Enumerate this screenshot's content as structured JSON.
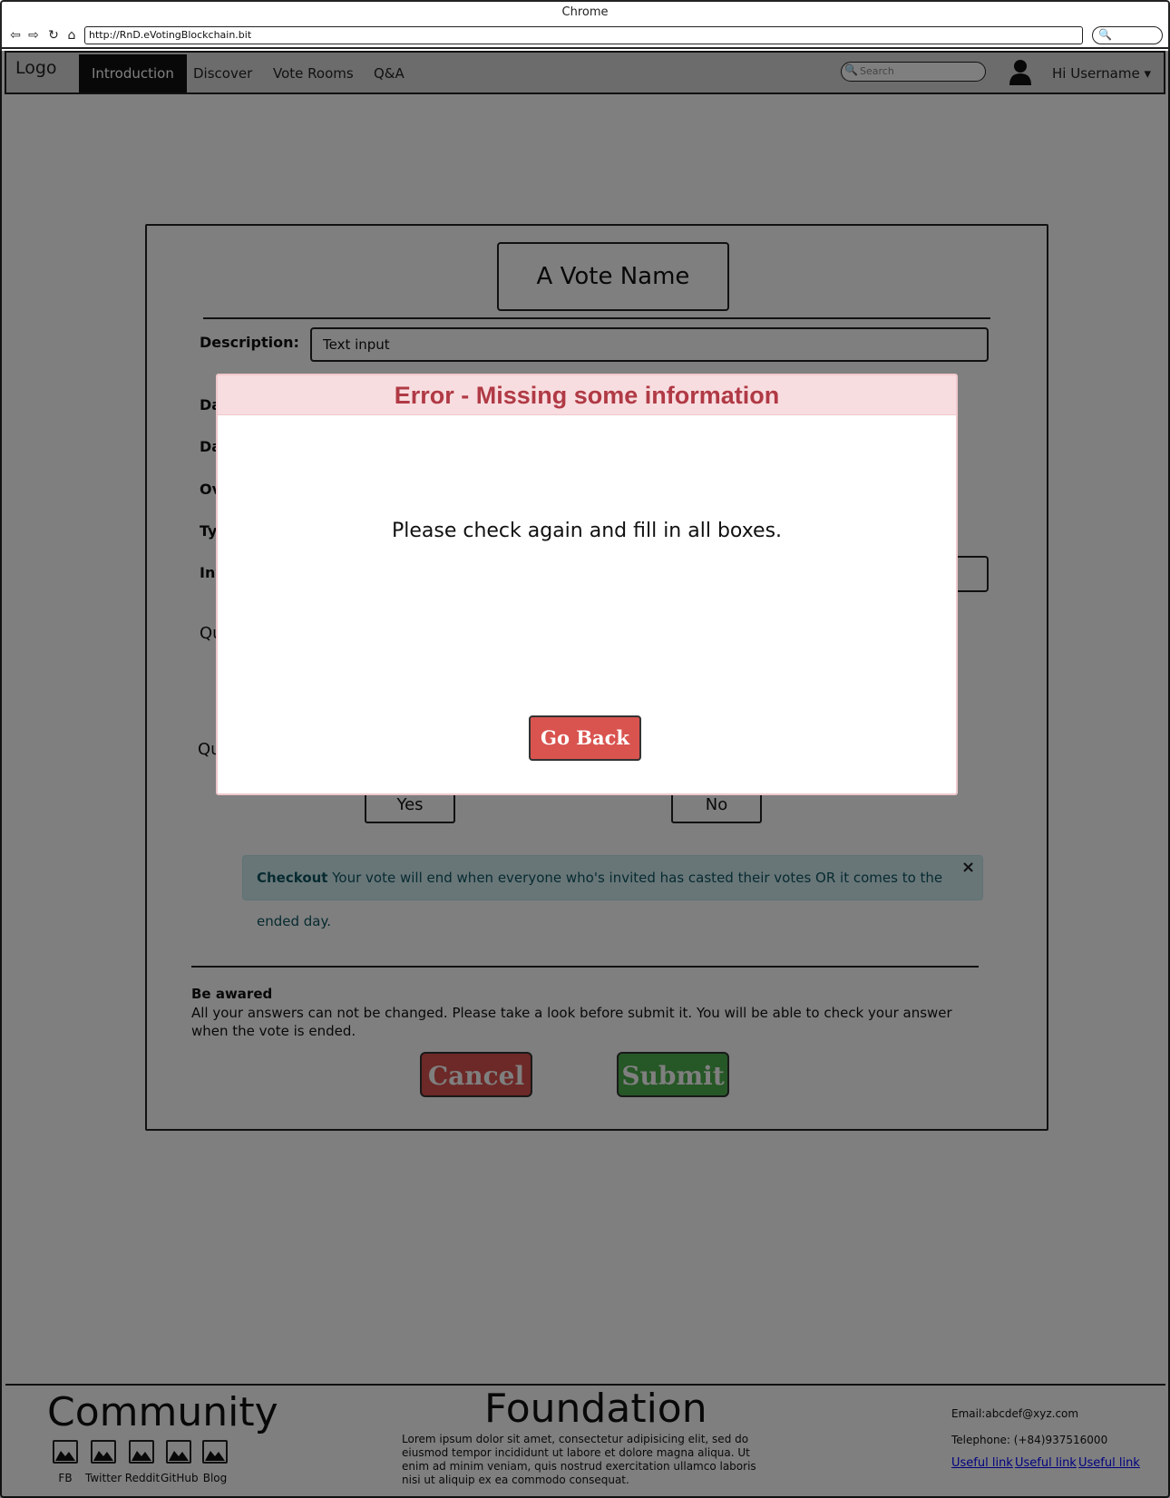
{
  "browser": {
    "title": "Chrome",
    "url": "http://RnD.eVotingBlockchain.bit"
  },
  "navbar": {
    "logo": "Logo",
    "items": [
      "Introduction",
      "Discover",
      "Vote Rooms",
      "Q&A"
    ],
    "active": "Introduction",
    "search_placeholder": "Search",
    "username": "Hi Username ▾"
  },
  "form": {
    "vote_name": "A Vote Name",
    "description_label": "Description:",
    "description_value": "Text input",
    "partial_labels": [
      "Da",
      "Da",
      "Ov",
      "Ty",
      "Inv",
      "Qu",
      "Qu"
    ],
    "yes_label": "Yes",
    "no_label": "No",
    "alert_bold": "Checkout",
    "alert_text": " Your vote will end when everyone who's invited has casted their votes OR it comes to the ended day.",
    "alert_close": "×",
    "aware_title": "Be awared",
    "aware_text": "All your answers can not be changed. Please take a look before submit it. You will be able to check your answer when the vote is ended.",
    "cancel_label": "Cancel",
    "submit_label": "Submit",
    "colors": {
      "cancel": "#d9534f",
      "submit": "#4cae4c"
    }
  },
  "footer": {
    "community_title": "Community",
    "social": [
      "FB",
      "Twitter",
      "Reddit",
      "GitHub",
      "Blog"
    ],
    "foundation_title": "Foundation",
    "lorem": "Lorem ipsum dolor sit amet, consectetur adipisicing elit, sed do eiusmod tempor incididunt ut labore et dolore magna aliqua. Ut enim ad minim veniam, quis nostrud exercitation ullamco laboris nisi ut aliquip ex ea commodo consequat.",
    "email": "Email:abcdef@xyz.com",
    "telephone": "Telephone: (+84)937516000",
    "links": [
      "Useful link",
      "Useful link",
      "Useful link"
    ]
  },
  "modal": {
    "title": "Error - Missing some information",
    "message": "Please check again and fill in all boxes.",
    "button": "Go Back",
    "colors": {
      "header_bg": "#f8dde0",
      "title": "#b03a45",
      "button": "#d9534f"
    }
  }
}
